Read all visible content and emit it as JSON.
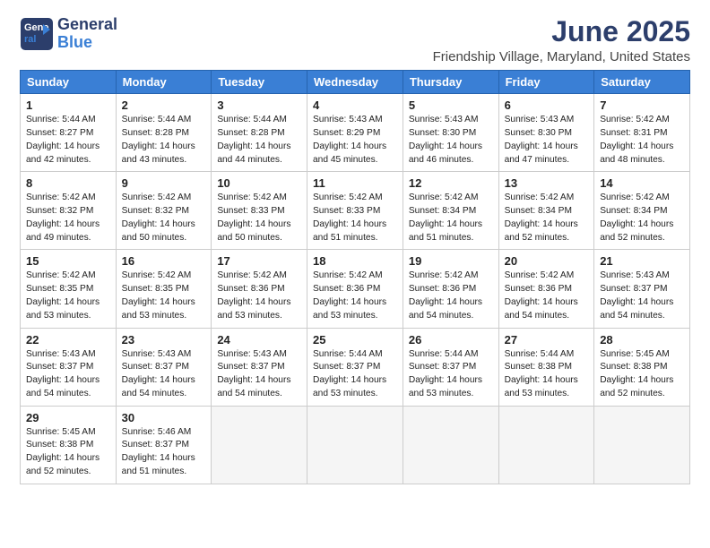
{
  "logo": {
    "general": "General",
    "blue": "Blue"
  },
  "title": "June 2025",
  "subtitle": "Friendship Village, Maryland, United States",
  "headers": [
    "Sunday",
    "Monday",
    "Tuesday",
    "Wednesday",
    "Thursday",
    "Friday",
    "Saturday"
  ],
  "weeks": [
    [
      {
        "day": "1",
        "info": "Sunrise: 5:44 AM\nSunset: 8:27 PM\nDaylight: 14 hours\nand 42 minutes."
      },
      {
        "day": "2",
        "info": "Sunrise: 5:44 AM\nSunset: 8:28 PM\nDaylight: 14 hours\nand 43 minutes."
      },
      {
        "day": "3",
        "info": "Sunrise: 5:44 AM\nSunset: 8:28 PM\nDaylight: 14 hours\nand 44 minutes."
      },
      {
        "day": "4",
        "info": "Sunrise: 5:43 AM\nSunset: 8:29 PM\nDaylight: 14 hours\nand 45 minutes."
      },
      {
        "day": "5",
        "info": "Sunrise: 5:43 AM\nSunset: 8:30 PM\nDaylight: 14 hours\nand 46 minutes."
      },
      {
        "day": "6",
        "info": "Sunrise: 5:43 AM\nSunset: 8:30 PM\nDaylight: 14 hours\nand 47 minutes."
      },
      {
        "day": "7",
        "info": "Sunrise: 5:42 AM\nSunset: 8:31 PM\nDaylight: 14 hours\nand 48 minutes."
      }
    ],
    [
      {
        "day": "8",
        "info": "Sunrise: 5:42 AM\nSunset: 8:32 PM\nDaylight: 14 hours\nand 49 minutes."
      },
      {
        "day": "9",
        "info": "Sunrise: 5:42 AM\nSunset: 8:32 PM\nDaylight: 14 hours\nand 50 minutes."
      },
      {
        "day": "10",
        "info": "Sunrise: 5:42 AM\nSunset: 8:33 PM\nDaylight: 14 hours\nand 50 minutes."
      },
      {
        "day": "11",
        "info": "Sunrise: 5:42 AM\nSunset: 8:33 PM\nDaylight: 14 hours\nand 51 minutes."
      },
      {
        "day": "12",
        "info": "Sunrise: 5:42 AM\nSunset: 8:34 PM\nDaylight: 14 hours\nand 51 minutes."
      },
      {
        "day": "13",
        "info": "Sunrise: 5:42 AM\nSunset: 8:34 PM\nDaylight: 14 hours\nand 52 minutes."
      },
      {
        "day": "14",
        "info": "Sunrise: 5:42 AM\nSunset: 8:34 PM\nDaylight: 14 hours\nand 52 minutes."
      }
    ],
    [
      {
        "day": "15",
        "info": "Sunrise: 5:42 AM\nSunset: 8:35 PM\nDaylight: 14 hours\nand 53 minutes."
      },
      {
        "day": "16",
        "info": "Sunrise: 5:42 AM\nSunset: 8:35 PM\nDaylight: 14 hours\nand 53 minutes."
      },
      {
        "day": "17",
        "info": "Sunrise: 5:42 AM\nSunset: 8:36 PM\nDaylight: 14 hours\nand 53 minutes."
      },
      {
        "day": "18",
        "info": "Sunrise: 5:42 AM\nSunset: 8:36 PM\nDaylight: 14 hours\nand 53 minutes."
      },
      {
        "day": "19",
        "info": "Sunrise: 5:42 AM\nSunset: 8:36 PM\nDaylight: 14 hours\nand 54 minutes."
      },
      {
        "day": "20",
        "info": "Sunrise: 5:42 AM\nSunset: 8:36 PM\nDaylight: 14 hours\nand 54 minutes."
      },
      {
        "day": "21",
        "info": "Sunrise: 5:43 AM\nSunset: 8:37 PM\nDaylight: 14 hours\nand 54 minutes."
      }
    ],
    [
      {
        "day": "22",
        "info": "Sunrise: 5:43 AM\nSunset: 8:37 PM\nDaylight: 14 hours\nand 54 minutes."
      },
      {
        "day": "23",
        "info": "Sunrise: 5:43 AM\nSunset: 8:37 PM\nDaylight: 14 hours\nand 54 minutes."
      },
      {
        "day": "24",
        "info": "Sunrise: 5:43 AM\nSunset: 8:37 PM\nDaylight: 14 hours\nand 54 minutes."
      },
      {
        "day": "25",
        "info": "Sunrise: 5:44 AM\nSunset: 8:37 PM\nDaylight: 14 hours\nand 53 minutes."
      },
      {
        "day": "26",
        "info": "Sunrise: 5:44 AM\nSunset: 8:37 PM\nDaylight: 14 hours\nand 53 minutes."
      },
      {
        "day": "27",
        "info": "Sunrise: 5:44 AM\nSunset: 8:38 PM\nDaylight: 14 hours\nand 53 minutes."
      },
      {
        "day": "28",
        "info": "Sunrise: 5:45 AM\nSunset: 8:38 PM\nDaylight: 14 hours\nand 52 minutes."
      }
    ],
    [
      {
        "day": "29",
        "info": "Sunrise: 5:45 AM\nSunset: 8:38 PM\nDaylight: 14 hours\nand 52 minutes."
      },
      {
        "day": "30",
        "info": "Sunrise: 5:46 AM\nSunset: 8:37 PM\nDaylight: 14 hours\nand 51 minutes."
      },
      {
        "day": "",
        "info": ""
      },
      {
        "day": "",
        "info": ""
      },
      {
        "day": "",
        "info": ""
      },
      {
        "day": "",
        "info": ""
      },
      {
        "day": "",
        "info": ""
      }
    ]
  ]
}
